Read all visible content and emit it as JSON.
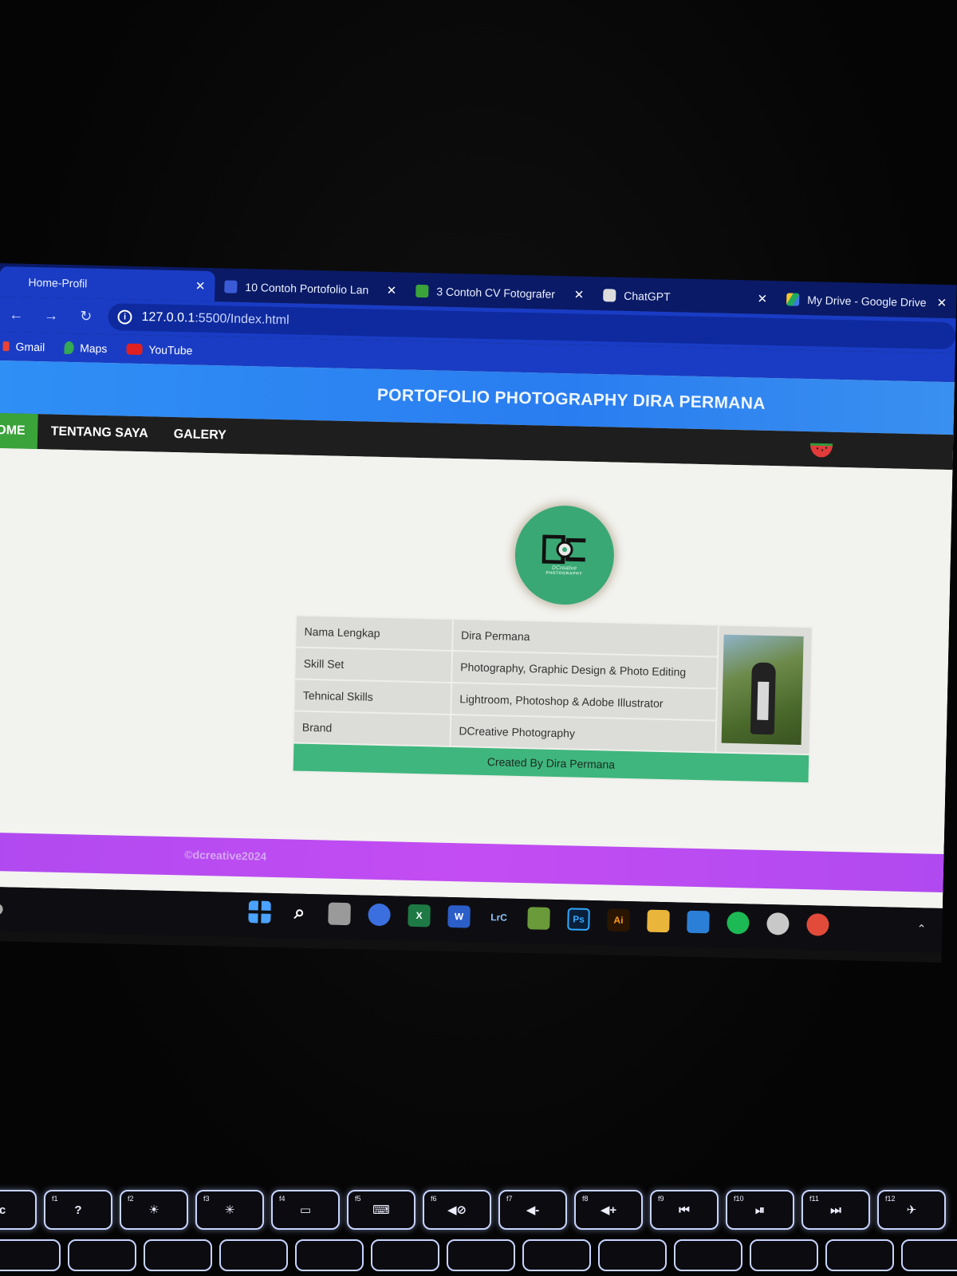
{
  "browser": {
    "tabs": [
      {
        "title": "Home-Profil",
        "active": true
      },
      {
        "title": "10 Contoh Portofolio Lan",
        "active": false
      },
      {
        "title": "3 Contoh CV Fotografer",
        "active": false
      },
      {
        "title": "ChatGPT",
        "active": false
      },
      {
        "title": "My Drive - Google Drive",
        "active": false
      }
    ],
    "address": {
      "host": "127.0.0.1",
      "path": ":5500/Index.html"
    },
    "bookmarks": [
      {
        "label": "Gmail",
        "icon": "gmail-icon"
      },
      {
        "label": "Maps",
        "icon": "maps-icon"
      },
      {
        "label": "YouTube",
        "icon": "youtube-icon"
      }
    ]
  },
  "site": {
    "title": "PORTOFOLIO PHOTOGRAPHY DIRA PERMANA",
    "nav": [
      {
        "label": "OME",
        "current": true
      },
      {
        "label": "TENTANG SAYA",
        "current": false
      },
      {
        "label": "GALERY",
        "current": false
      }
    ],
    "logo": {
      "text": "DCreative",
      "sub": "PHOTOGRAPHY"
    },
    "profile": [
      {
        "label": "Nama Lengkap",
        "value": "Dira Permana"
      },
      {
        "label": "Skill Set",
        "value": "Photography, Graphic Design & Photo Editing"
      },
      {
        "label": "Tehnical Skills",
        "value": "Lightroom, Photoshop & Adobe Illustrator"
      },
      {
        "label": "Brand",
        "value": "DCreative Photography"
      }
    ],
    "table_footer": "Created By Dira Permana",
    "copyright": "©dcreative2024"
  },
  "taskbar": {
    "apps": [
      {
        "name": "start-icon",
        "label": "",
        "color": "#4aa3ff"
      },
      {
        "name": "search-icon",
        "label": "",
        "color": "#0e0e12"
      },
      {
        "name": "task-view-icon",
        "label": "",
        "color": "#9a9a9a"
      },
      {
        "name": "meet-icon",
        "label": "",
        "color": "#3b6fe0"
      },
      {
        "name": "excel-icon",
        "label": "X",
        "color": "#1e7a45"
      },
      {
        "name": "word-icon",
        "label": "W",
        "color": "#2b5ec9"
      },
      {
        "name": "lightroom-icon",
        "label": "LrC",
        "color": "#0e0e12"
      },
      {
        "name": "image-app-icon",
        "label": "",
        "color": "#6a9a3a"
      },
      {
        "name": "photoshop-icon",
        "label": "Ps",
        "color": "#0a1f3a"
      },
      {
        "name": "illustrator-icon",
        "label": "Ai",
        "color": "#2a1600"
      },
      {
        "name": "file-explorer-icon",
        "label": "",
        "color": "#e9b53a"
      },
      {
        "name": "vscode-icon",
        "label": "",
        "color": "#2c7fd6"
      },
      {
        "name": "spotify-icon",
        "label": "",
        "color": "#1db954"
      },
      {
        "name": "cursor-app-icon",
        "label": "",
        "color": "#c8c8c8"
      },
      {
        "name": "chrome-icon",
        "label": "",
        "color": "#e24a3a"
      }
    ]
  },
  "keyboard": {
    "keys": [
      {
        "fn": "",
        "glyph": "c"
      },
      {
        "fn": "f1",
        "glyph": "?"
      },
      {
        "fn": "f2",
        "glyph": "☀"
      },
      {
        "fn": "f3",
        "glyph": "✳"
      },
      {
        "fn": "f4",
        "glyph": "▭"
      },
      {
        "fn": "f5",
        "glyph": "⌨"
      },
      {
        "fn": "f6",
        "glyph": "◀⊘"
      },
      {
        "fn": "f7",
        "glyph": "◀-"
      },
      {
        "fn": "f8",
        "glyph": "◀+"
      },
      {
        "fn": "f9",
        "glyph": "⏮"
      },
      {
        "fn": "f10",
        "glyph": "⏯"
      },
      {
        "fn": "f11",
        "glyph": "⏭"
      },
      {
        "fn": "f12",
        "glyph": "✈"
      }
    ]
  }
}
